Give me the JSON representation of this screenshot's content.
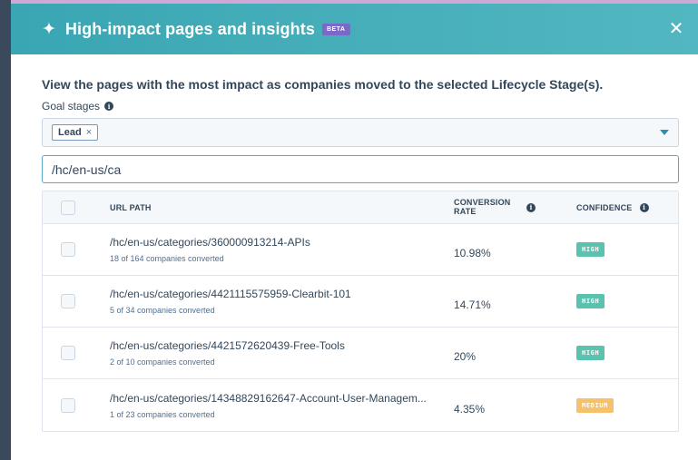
{
  "modal": {
    "title": "High-impact pages and insights",
    "beta": "BETA",
    "close": "✕",
    "sparkle": "✦"
  },
  "heading": "View the pages with the most impact as companies moved to the selected Lifecycle Stage(s).",
  "goal_stages": {
    "label": "Goal stages",
    "info": "i",
    "tags": [
      {
        "label": "Lead",
        "remove": "×"
      }
    ]
  },
  "search": {
    "value": "/hc/en-us/ca"
  },
  "table": {
    "headers": {
      "url": "URL PATH",
      "rate": "CONVERSION RATE",
      "confidence": "CONFIDENCE",
      "info": "i"
    },
    "rows": [
      {
        "url": "/hc/en-us/categories/360000913214-APIs",
        "sub": "18 of 164 companies converted",
        "rate": "10.98%",
        "confidence": "HIGH"
      },
      {
        "url": "/hc/en-us/categories/4421115575959-Clearbit-101",
        "sub": "5 of 34 companies converted",
        "rate": "14.71%",
        "confidence": "HIGH"
      },
      {
        "url": "/hc/en-us/categories/4421572620439-Free-Tools",
        "sub": "2 of 10 companies converted",
        "rate": "20%",
        "confidence": "HIGH"
      },
      {
        "url": "/hc/en-us/categories/14348829162647-Account-User-Managem...",
        "sub": "1 of 23 companies converted",
        "rate": "4.35%",
        "confidence": "MEDIUM"
      }
    ]
  },
  "colors": {
    "header_gradient_start": "#3aa6b3",
    "header_gradient_end": "#52b7c0",
    "beta_badge": "#7b68c8",
    "high_badge": "#5cc2b0",
    "medium_badge": "#f5c26b",
    "backdrop": "#cfa9d6"
  }
}
